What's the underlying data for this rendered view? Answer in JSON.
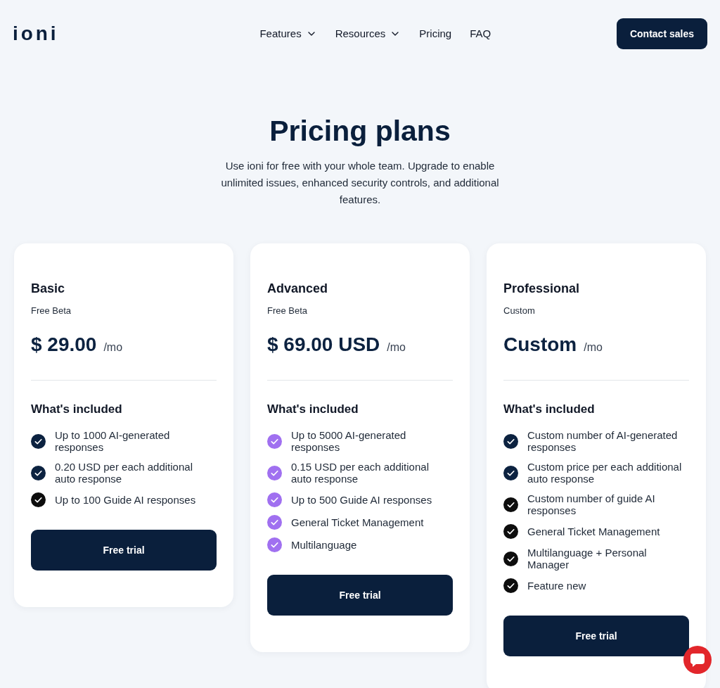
{
  "header": {
    "logo": "ioni",
    "nav": [
      {
        "label": "Features",
        "dropdown": true
      },
      {
        "label": "Resources",
        "dropdown": true
      },
      {
        "label": "Pricing",
        "dropdown": false
      },
      {
        "label": "FAQ",
        "dropdown": false
      }
    ],
    "cta": "Contact sales"
  },
  "hero": {
    "title": "Pricing plans",
    "subtitle": "Use ioni for free with your whole team. Upgrade to enable unlimited issues, enhanced security controls, and additional features."
  },
  "plans": [
    {
      "name": "Basic",
      "tier": "Free Beta",
      "price": "$ 29.00",
      "period": "/mo",
      "included_heading": "What's included",
      "features": [
        {
          "text": "Up to 1000 AI-generated responses",
          "color": "#0c2240"
        },
        {
          "text": "0.20 USD per each additional auto response",
          "color": "#0c2240"
        },
        {
          "text": "Up to 100 Guide AI responses",
          "color": "#0d0d0d"
        }
      ],
      "button": "Free trial"
    },
    {
      "name": "Advanced",
      "tier": "Free Beta",
      "price": "$ 69.00 USD",
      "period": "/mo",
      "included_heading": "What's included",
      "features": [
        {
          "text": "Up to 5000 AI-generated responses",
          "color": "#a070f0"
        },
        {
          "text": "0.15 USD per each additional auto response",
          "color": "#a070f0"
        },
        {
          "text": "Up to 500 Guide AI responses",
          "color": "#a070f0"
        },
        {
          "text": "General Ticket Management",
          "color": "#a070f0"
        },
        {
          "text": "Multilanguage",
          "color": "#a070f0"
        }
      ],
      "button": "Free trial"
    },
    {
      "name": "Professional",
      "tier": "Custom",
      "price": "Custom",
      "period": "/mo",
      "included_heading": "What's included",
      "features": [
        {
          "text": "Custom number of AI-generated responses",
          "color": "#0c2240"
        },
        {
          "text": "Custom price per each additional auto response",
          "color": "#0c2240"
        },
        {
          "text": "Custom number of guide AI responses",
          "color": "#0d0d0d"
        },
        {
          "text": "General Ticket Management",
          "color": "#0d0d0d"
        },
        {
          "text": "Multilanguage + Personal Manager",
          "color": "#0d0d0d"
        },
        {
          "text": "Feature new",
          "color": "#0d0d0d"
        }
      ],
      "button": "Free trial"
    }
  ]
}
